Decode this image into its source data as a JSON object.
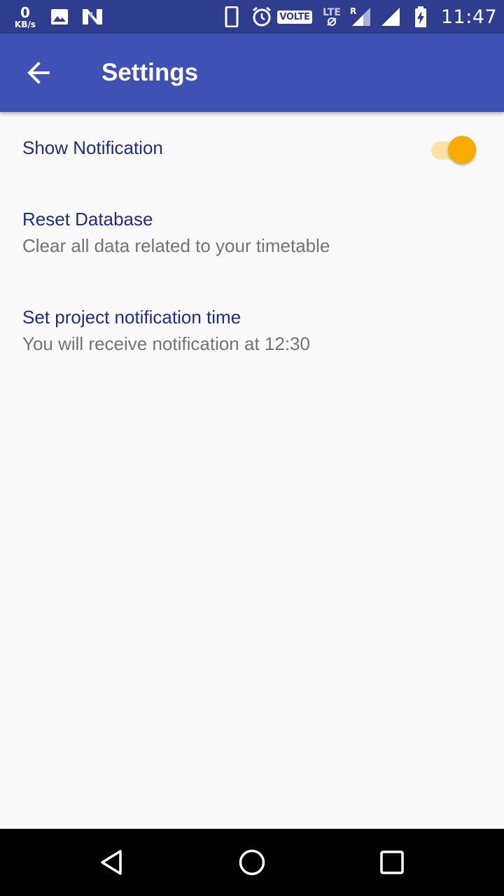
{
  "status_bar": {
    "speed_value": "0",
    "speed_unit": "KB/s",
    "volte": "VOLTE",
    "lte": "LTE",
    "roaming": "R",
    "time": "11:47",
    "icons": [
      "image-icon",
      "n-logo-icon",
      "phone-icon",
      "alarm-icon",
      "wifi-off-icon",
      "signal-icon",
      "signal-icon",
      "battery-charging-icon"
    ]
  },
  "app_bar": {
    "title": "Settings",
    "back_icon": "arrow-left-icon",
    "color": "#3f51b5"
  },
  "settings": {
    "show_notification": {
      "title": "Show Notification",
      "enabled": true
    },
    "reset_database": {
      "title": "Reset Database",
      "summary": "Clear all data related to your timetable"
    },
    "project_notification_time": {
      "title": "Set project notification time",
      "summary": "You will receive notification at 12:30"
    }
  },
  "nav_bar": {
    "icons": [
      "back-triangle-icon",
      "home-circle-icon",
      "recents-square-icon"
    ]
  },
  "colors": {
    "status_bar": "#2f3d8f",
    "accent": "#f9ab00",
    "title_text": "#1f2e7e",
    "summary_text": "#737373"
  }
}
